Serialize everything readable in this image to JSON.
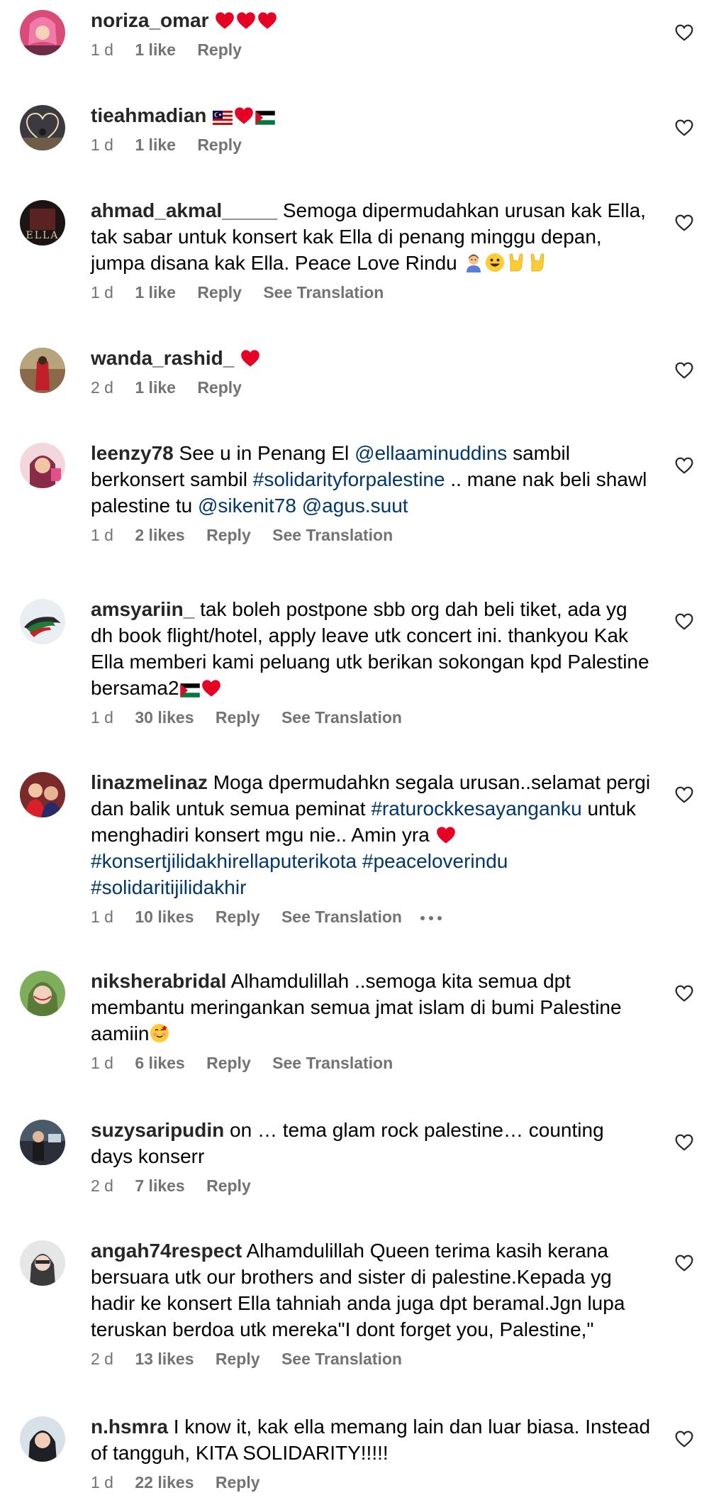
{
  "colors": {
    "username": "#262626",
    "meta": "#737373",
    "link": "#00376b",
    "heart_red": "#e60023"
  },
  "comments": [
    {
      "username": "noriza_omar",
      "text": "",
      "time": "1 d",
      "likes": "1 like",
      "reply": "Reply",
      "translation": ""
    },
    {
      "username": "tieahmadian",
      "text": "",
      "time": "1 d",
      "likes": "1 like",
      "reply": "Reply",
      "translation": ""
    },
    {
      "username": "ahmad_akmal_____",
      "text": "Semoga dipermudahkan urusan kak Ella, tak sabar untuk konsert kak Ella di penang minggu depan, jumpa disana kak Ella. Peace Love Rindu",
      "time": "1 d",
      "likes": "1 like",
      "reply": "Reply",
      "translation": "See Translation"
    },
    {
      "username": "wanda_rashid_",
      "text": "",
      "time": "2 d",
      "likes": "1 like",
      "reply": "Reply",
      "translation": ""
    },
    {
      "username": "leenzy78",
      "text_a": "See u in Penang El",
      "mention_a": "@ellaaminuddins",
      "text_b": "sambil berkonsert sambil",
      "hashtag_a": "#solidarityforpalestine",
      "text_c": ".. mane nak beli shawl palestine tu",
      "mention_b": "@sikenit78",
      "mention_c": "@agus.suut",
      "time": "1 d",
      "likes": "2 likes",
      "reply": "Reply",
      "translation": "See Translation"
    },
    {
      "username": "amsyariin_",
      "text": "tak boleh postpone sbb org dah beli tiket, ada yg dh book flight/hotel, apply leave utk concert ini. thankyou Kak Ella memberi kami peluang utk berikan sokongan kpd Palestine bersama2",
      "time": "1 d",
      "likes": "30 likes",
      "reply": "Reply",
      "translation": "See Translation"
    },
    {
      "username": "linazmelinaz",
      "text_a": "Moga dpermudahkn segala urusan..selamat pergi dan balik untuk semua peminat",
      "hashtag_a": "#raturockkesayanganku",
      "text_b": "untuk menghadiri konsert mgu nie.. Amin yra",
      "hashtag_b": "#konsertjilidakhirellaputerikota",
      "hashtag_c": "#peaceloverindu",
      "hashtag_d": "#solidaritijilidakhir",
      "time": "1 d",
      "likes": "10 likes",
      "reply": "Reply",
      "translation": "See Translation",
      "more": "more-options-icon"
    },
    {
      "username": "niksherabridal",
      "text": "Alhamdulillah ..semoga kita semua dpt membantu meringankan semua jmat islam di bumi Palestine aamiin",
      "time": "1 d",
      "likes": "6 likes",
      "reply": "Reply",
      "translation": "See Translation"
    },
    {
      "username": "suzysaripudin",
      "text": "on … tema glam rock palestine… counting days konserr",
      "time": "2 d",
      "likes": "7 likes",
      "reply": "Reply",
      "translation": ""
    },
    {
      "username": "angah74respect",
      "text": "Alhamdulillah Queen terima kasih kerana bersuara utk our brothers and sister di palestine.Kepada yg hadir ke konsert Ella tahniah anda juga dpt beramal.Jgn lupa teruskan berdoa utk mereka\"I dont forget you, Palestine,\"",
      "time": "2 d",
      "likes": "13 likes",
      "reply": "Reply",
      "translation": "See Translation"
    },
    {
      "username": "n.hsmra",
      "text": "I know it, kak ella memang lain dan luar biasa. Instead of tangguh, KITA SOLIDARITY!!!!!",
      "time": "1 d",
      "likes": "22 likes",
      "reply": "Reply",
      "translation": ""
    }
  ]
}
